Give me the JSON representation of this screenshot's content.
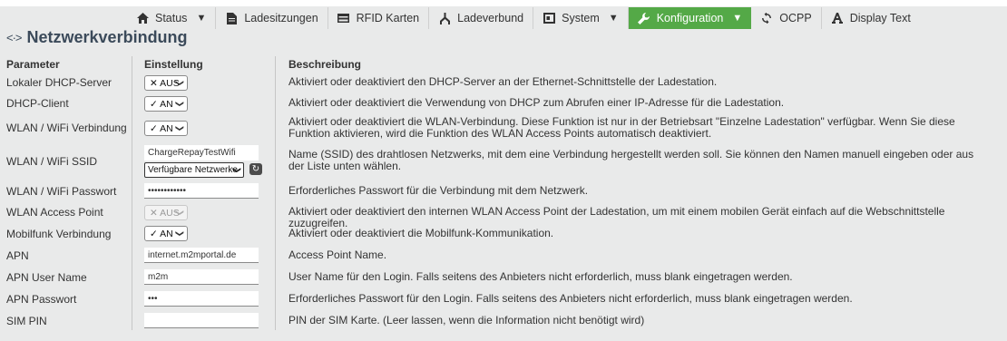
{
  "nav": {
    "items": [
      {
        "label": "Status",
        "icon": "home-icon",
        "caret": "▼"
      },
      {
        "label": "Ladesitzungen",
        "icon": "document-icon"
      },
      {
        "label": "RFID Karten",
        "icon": "card-icon"
      },
      {
        "label": "Ladeverbund",
        "icon": "network-icon"
      },
      {
        "label": "System",
        "icon": "server-icon",
        "caret": "▼"
      },
      {
        "label": "Konfiguration",
        "icon": "wrench-icon",
        "caret": "▼",
        "active": true
      },
      {
        "label": "OCPP",
        "icon": "sync-icon"
      },
      {
        "label": "Display Text",
        "icon": "text-icon"
      }
    ],
    "active_color": "#54a947"
  },
  "page": {
    "title_icon": "<·>",
    "title": "Netzwerkverbindung"
  },
  "table": {
    "headers": {
      "param": "Parameter",
      "setting": "Einstellung",
      "desc": "Beschreibung"
    },
    "rows": [
      {
        "param": "Lokaler DHCP-Server",
        "control": "select",
        "value": "✕ AUS",
        "desc": "Aktiviert oder deaktiviert den DHCP-Server an der Ethernet-Schnittstelle der Ladestation."
      },
      {
        "param": "DHCP-Client",
        "control": "select",
        "value": "✓ AN",
        "desc": "Aktiviert oder deaktiviert die Verwendung von DHCP zum Abrufen einer IP-Adresse für die Ladestation."
      },
      {
        "param": "WLAN / WiFi Verbindung",
        "control": "select",
        "value": "✓ AN",
        "desc": "Aktiviert oder deaktiviert die WLAN-Verbindung. Diese Funktion ist nur in der Betriebsart \"Einzelne Ladestation\" verfügbar. Wenn Sie diese Funktion aktivieren, wird die Funktion des WLAN Access Points automatisch deaktiviert."
      },
      {
        "param": "WLAN / WiFi SSID",
        "control": "ssid",
        "value": "ChargeRepayTestWifi",
        "select_value": "Verfügbare Netzwerke",
        "desc": "Name (SSID) des drahtlosen Netzwerks, mit dem eine Verbindung hergestellt werden soll. Sie können den Namen manuell eingeben oder aus der Liste unten wählen."
      },
      {
        "param": "WLAN / WiFi Passwort",
        "control": "input",
        "value": "••••••••••••",
        "desc": "Erforderliches Passwort für die Verbindung mit dem Netzwerk."
      },
      {
        "param": "WLAN Access Point",
        "control": "select-disabled",
        "value": "✕ AUS",
        "desc": "Aktiviert oder deaktiviert den internen WLAN Access Point der Ladestation, um mit einem mobilen Gerät einfach auf die Webschnittstelle zuzugreifen."
      },
      {
        "param": "Mobilfunk Verbindung",
        "control": "select",
        "value": "✓ AN",
        "desc": "Aktiviert oder deaktiviert die Mobilfunk-Kommunikation."
      },
      {
        "param": "APN",
        "control": "input",
        "value": "internet.m2mportal.de",
        "desc": "Access Point Name."
      },
      {
        "param": "APN User Name",
        "control": "input",
        "value": "m2m",
        "desc": "User Name für den Login. Falls seitens des Anbieters nicht erforderlich, muss blank eingetragen werden."
      },
      {
        "param": "APN Passwort",
        "control": "input",
        "value": "•••",
        "desc": "Erforderliches Passwort für den Login. Falls seitens des Anbieters nicht erforderlich, muss blank eingetragen werden."
      },
      {
        "param": "SIM PIN",
        "control": "input",
        "value": "",
        "desc": "PIN der SIM Karte. (Leer lassen, wenn die Information nicht benötigt wird)"
      }
    ]
  }
}
